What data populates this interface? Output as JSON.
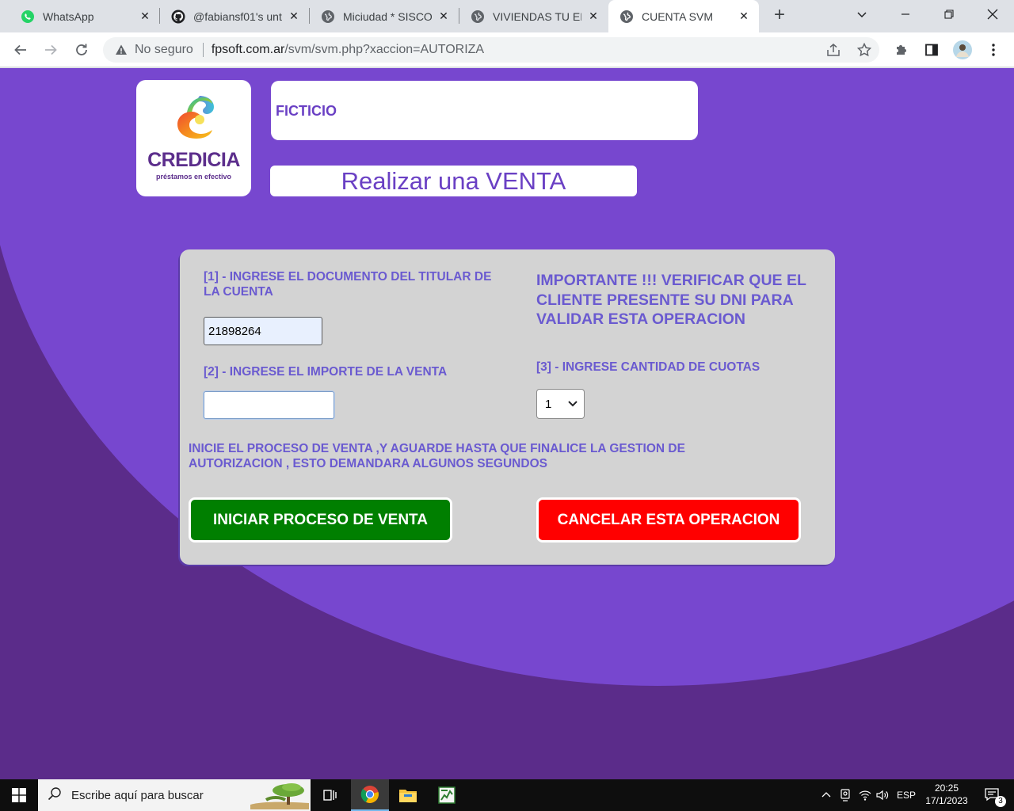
{
  "browser": {
    "tabs": [
      {
        "title": "WhatsApp",
        "icon": "whatsapp-icon",
        "active": false
      },
      {
        "title": "@fabiansf01's unt",
        "icon": "github-icon",
        "active": false
      },
      {
        "title": "Miciudad * SISCO",
        "icon": "globe-icon",
        "active": false
      },
      {
        "title": "VIVIENDAS TU EL",
        "icon": "globe-icon",
        "active": false
      },
      {
        "title": "CUENTA SVM",
        "icon": "globe-icon",
        "active": true
      }
    ],
    "security_label": "No seguro",
    "url_domain": "fpsoft.com.ar",
    "url_path": "/svm/svm.php?xaccion=AUTORIZA"
  },
  "page": {
    "logo": {
      "brand": "CREDICIA",
      "tagline": "préstamos en efectivo"
    },
    "account_name": "FICTICIO",
    "title": "Realizar una VENTA",
    "form": {
      "doc_label": "[1] - INGRESE EL DOCUMENTO DEL TITULAR DE LA CUENTA",
      "doc_value": "21898264",
      "important_text": "IMPORTANTE !!! VERIFICAR QUE EL CLIENTE PRESENTE SU DNI PARA VALIDAR ESTA OPERACION",
      "amount_label": "[2] - INGRESE EL IMPORTE DE LA VENTA",
      "amount_value": "",
      "cuotas_label": "[3] - INGRESE CANTIDAD DE CUOTAS",
      "cuotas_value": "1",
      "process_note": "INICIE EL PROCESO DE VENTA ,Y AGUARDE HASTA QUE FINALICE LA GESTION DE AUTORIZACION , ESTO DEMANDARA ALGUNOS SEGUNDOS",
      "start_button": "INICIAR PROCESO DE VENTA",
      "cancel_button": "CANCELAR ESTA OPERACION"
    },
    "colors": {
      "background": "#5b2c8a",
      "accent": "#7747cf",
      "label": "#6a5ad0",
      "start": "#007f00",
      "cancel": "#ff0000"
    }
  },
  "taskbar": {
    "search_placeholder": "Escribe aquí para buscar",
    "language": "ESP",
    "time": "20:25",
    "date": "17/1/2023",
    "notifications": "3"
  }
}
